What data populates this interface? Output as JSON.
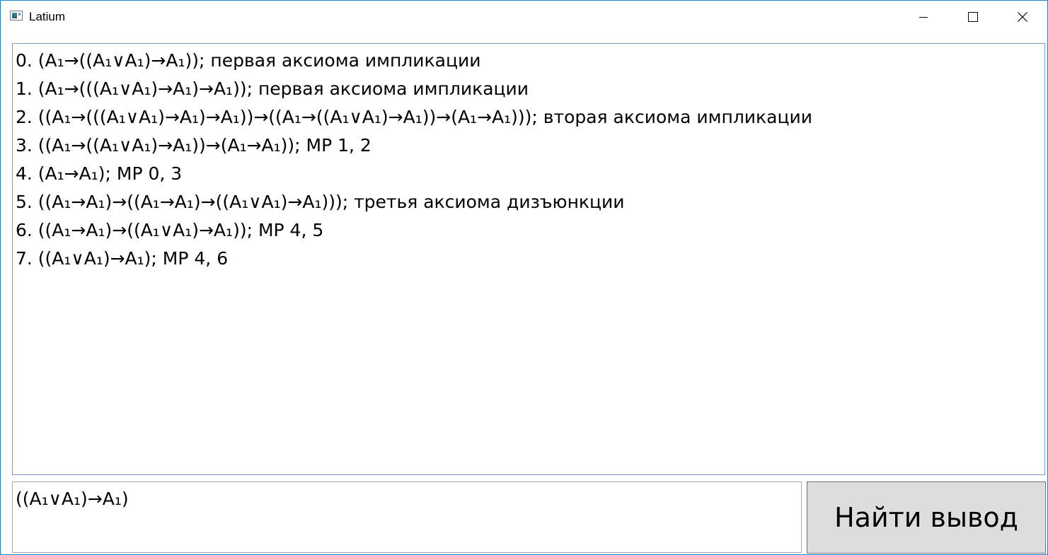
{
  "window": {
    "title": "Latium",
    "accent_color": "#1883d7"
  },
  "caption_buttons": {
    "minimize_icon": "minimize-icon",
    "maximize_icon": "maximize-icon",
    "close_icon": "close-icon"
  },
  "proof": {
    "lines": [
      "0. (A₁→((A₁∨A₁)→A₁)); первая аксиома импликации",
      "1. (A₁→(((A₁∨A₁)→A₁)→A₁)); первая аксиома импликации",
      "2. ((A₁→(((A₁∨A₁)→A₁)→A₁))→((A₁→((A₁∨A₁)→A₁))→(A₁→A₁))); вторая аксиома импликации",
      "3. ((A₁→((A₁∨A₁)→A₁))→(A₁→A₁)); MP 1, 2",
      "4. (A₁→A₁); MP 0, 3",
      "5. ((A₁→A₁)→((A₁→A₁)→((A₁∨A₁)→A₁))); третья аксиома дизъюнкции",
      "6. ((A₁→A₁)→((A₁∨A₁)→A₁)); MP 4, 5",
      "7. ((A₁∨A₁)→A₁); MP 4, 6"
    ]
  },
  "input": {
    "value": "((A₁∨A₁)→A₁)"
  },
  "button": {
    "label": "Найти вывод"
  }
}
